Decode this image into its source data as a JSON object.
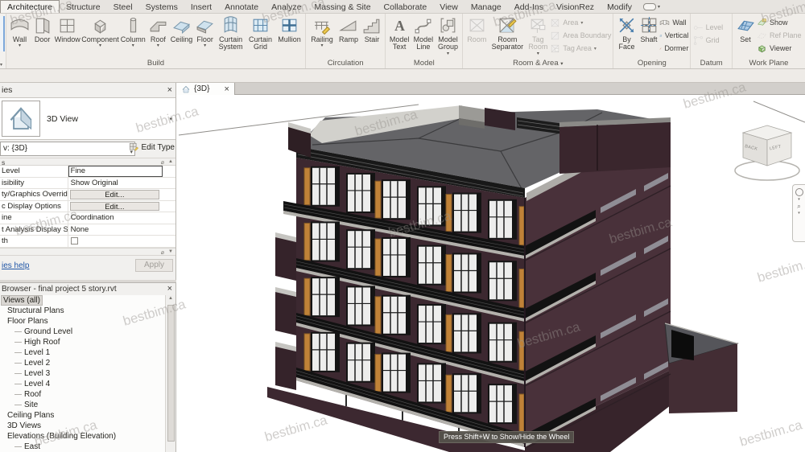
{
  "app": {
    "tabs": [
      "Architecture",
      "Structure",
      "Steel",
      "Systems",
      "Insert",
      "Annotate",
      "Analyze",
      "Massing & Site",
      "Collaborate",
      "View",
      "Manage",
      "Add-Ins",
      "VisionRez",
      "Modify"
    ],
    "active_tab": "Architecture"
  },
  "ribbon": {
    "panels": [
      {
        "label": "Build",
        "buttons": [
          {
            "label": "Wall",
            "arrow": true
          },
          {
            "label": "Door"
          },
          {
            "label": "Window"
          },
          {
            "label": "Component",
            "arrow": true
          },
          {
            "label": "Column",
            "arrow": true
          },
          {
            "label": "Roof",
            "arrow": true
          },
          {
            "label": "Ceiling"
          },
          {
            "label": "Floor",
            "arrow": true
          },
          {
            "label": "Curtain System"
          },
          {
            "label": "Curtain Grid"
          },
          {
            "label": "Mullion"
          }
        ]
      },
      {
        "label": "Circulation",
        "buttons": [
          {
            "label": "Railing",
            "arrow": true
          },
          {
            "label": "Ramp"
          },
          {
            "label": "Stair"
          }
        ]
      },
      {
        "label": "Model",
        "buttons": [
          {
            "label": "Model Text"
          },
          {
            "label": "Model Line"
          },
          {
            "label": "Model Group",
            "arrow": true
          }
        ]
      },
      {
        "label": "Room & Area",
        "panel_arrow": true,
        "buttons": [
          {
            "label": "Room",
            "disabled": true
          },
          {
            "label": "Room Separator"
          },
          {
            "label": "Tag Room",
            "disabled": true,
            "arrow": true
          }
        ],
        "small_buttons": [
          {
            "label": "Area",
            "arrow": true,
            "disabled": true
          },
          {
            "label": "Area Boundary",
            "disabled": true
          },
          {
            "label": "Tag Area",
            "arrow": true,
            "disabled": true
          }
        ]
      },
      {
        "label": "Opening",
        "buttons": [
          {
            "label": "By Face"
          },
          {
            "label": "Shaft"
          }
        ],
        "small_buttons": [
          {
            "label": "Wall"
          },
          {
            "label": "Vertical"
          },
          {
            "label": "Dormer"
          }
        ]
      },
      {
        "label": "Datum",
        "small_buttons": [
          {
            "label": "Level",
            "disabled": true
          },
          {
            "label": "Grid",
            "disabled": true
          }
        ]
      },
      {
        "label": "Work Plane",
        "buttons": [
          {
            "label": "Set"
          }
        ],
        "small_buttons": [
          {
            "label": "Show"
          },
          {
            "label": "Ref Plane",
            "disabled": true
          },
          {
            "label": "Viewer"
          }
        ]
      }
    ]
  },
  "properties": {
    "title": "ies",
    "type_selector": {
      "label": "3D View"
    },
    "instance_selector": {
      "value": "v: {3D}",
      "edit_type_label": "Edit Type"
    },
    "section_label": "s",
    "rows": [
      {
        "label": "Level",
        "value": "Fine",
        "kind": "input-focused"
      },
      {
        "label": "isibility",
        "value": "Show Original",
        "kind": "text"
      },
      {
        "label": "ty/Graphics Overrides",
        "value": "Edit...",
        "kind": "button"
      },
      {
        "label": "c Display Options",
        "value": "Edit...",
        "kind": "button"
      },
      {
        "label": "ine",
        "value": "Coordination",
        "kind": "text"
      },
      {
        "label": "t Analysis Display Style",
        "value": "None",
        "kind": "text"
      },
      {
        "label": "th",
        "value": "",
        "kind": "checkbox"
      }
    ],
    "help_link": "ies help",
    "apply_label": "Apply"
  },
  "browser": {
    "title": "Browser - final project 5 story.rvt",
    "items": [
      {
        "label": "Views (all)",
        "indent": 0,
        "selected": true
      },
      {
        "label": "Structural Plans",
        "indent": 1
      },
      {
        "label": "Floor Plans",
        "indent": 1
      },
      {
        "label": "Ground Level",
        "indent": 2
      },
      {
        "label": "High Roof",
        "indent": 2
      },
      {
        "label": "Level 1",
        "indent": 2
      },
      {
        "label": "Level 2",
        "indent": 2
      },
      {
        "label": "Level 3",
        "indent": 2
      },
      {
        "label": "Level 4",
        "indent": 2
      },
      {
        "label": "Roof",
        "indent": 2
      },
      {
        "label": "Site",
        "indent": 2
      },
      {
        "label": "Ceiling Plans",
        "indent": 1
      },
      {
        "label": "3D Views",
        "indent": 1
      },
      {
        "label": "Elevations (Building Elevation)",
        "indent": 1
      },
      {
        "label": "East",
        "indent": 2
      }
    ]
  },
  "canvas": {
    "view_tab": "{3D}",
    "tooltip": "Press Shift+W to Show/Hide the Wheel",
    "viewcube": {
      "back": "BACK",
      "left": "LEFT"
    },
    "watermark_text": "bestbim.ca"
  },
  "colors": {
    "wall_left": "#3c2830",
    "wall_right": "#49313a",
    "wall_base": "#3c2830",
    "roof_gray": "#646467",
    "slab_light": "#b3b1ac",
    "railing_dark": "#121212",
    "accent_orange": "#c08238",
    "glazing": "#ededec",
    "selection_blue": "#7da7d9"
  }
}
